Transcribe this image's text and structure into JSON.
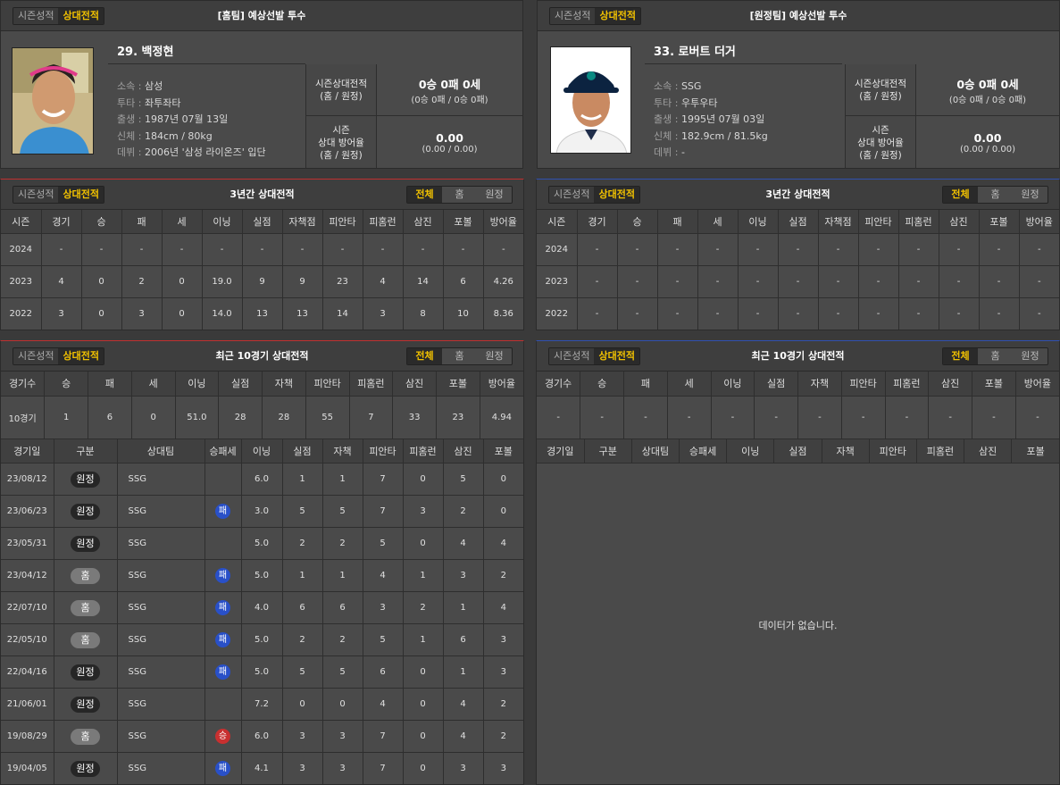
{
  "tabs": {
    "season": "시즌성적",
    "vs": "상대전적",
    "all": "전체",
    "home": "홈",
    "away": "원정"
  },
  "home": {
    "title": "[홈팀] 예상선발 투수",
    "name": "29. 백정현",
    "info": [
      {
        "k": "소속",
        "v": "삼성"
      },
      {
        "k": "투타",
        "v": "좌투좌타"
      },
      {
        "k": "출생",
        "v": "1987년 07월 13일"
      },
      {
        "k": "신체",
        "v": "184cm / 80kg"
      },
      {
        "k": "데뷔",
        "v": "2006년 '삼성 라이온즈' 입단"
      }
    ],
    "record_label_1": "시즌상대전적",
    "record_label_1b": "(홈 / 원정)",
    "record_main": "0승 0패 0세",
    "record_sub": "(0승 0패 / 0승 0패)",
    "era_label_1": "시즌",
    "era_label_2": "상대 방어율",
    "era_label_3": "(홈 / 원정)",
    "era_main": "0.00",
    "era_sub": "(0.00 / 0.00)"
  },
  "away": {
    "title": "[원정팀] 예상선발 투수",
    "name": "33. 로버트 더거",
    "info": [
      {
        "k": "소속",
        "v": "SSG"
      },
      {
        "k": "투타",
        "v": "우투우타"
      },
      {
        "k": "출생",
        "v": "1995년 07월 03일"
      },
      {
        "k": "신체",
        "v": "182.9cm / 81.5kg"
      },
      {
        "k": "데뷔",
        "v": "-"
      }
    ],
    "record_label_1": "시즌상대전적",
    "record_label_1b": "(홈 / 원정)",
    "record_main": "0승 0패 0세",
    "record_sub": "(0승 0패 / 0승 0패)",
    "era_label_1": "시즌",
    "era_label_2": "상대 방어율",
    "era_label_3": "(홈 / 원정)",
    "era_main": "0.00",
    "era_sub": "(0.00 / 0.00)"
  },
  "three_year": {
    "title": "3년간 상대전적",
    "headers": [
      "시즌",
      "경기",
      "승",
      "패",
      "세",
      "이닝",
      "실점",
      "자책점",
      "피안타",
      "피홈런",
      "삼진",
      "포볼",
      "방어율"
    ],
    "home_rows": [
      [
        "2024",
        "-",
        "-",
        "-",
        "-",
        "-",
        "-",
        "-",
        "-",
        "-",
        "-",
        "-",
        "-"
      ],
      [
        "2023",
        "4",
        "0",
        "2",
        "0",
        "19.0",
        "9",
        "9",
        "23",
        "4",
        "14",
        "6",
        "4.26"
      ],
      [
        "2022",
        "3",
        "0",
        "3",
        "0",
        "14.0",
        "13",
        "13",
        "14",
        "3",
        "8",
        "10",
        "8.36"
      ]
    ],
    "away_rows": [
      [
        "2024",
        "-",
        "-",
        "-",
        "-",
        "-",
        "-",
        "-",
        "-",
        "-",
        "-",
        "-",
        "-"
      ],
      [
        "2023",
        "-",
        "-",
        "-",
        "-",
        "-",
        "-",
        "-",
        "-",
        "-",
        "-",
        "-",
        "-"
      ],
      [
        "2022",
        "-",
        "-",
        "-",
        "-",
        "-",
        "-",
        "-",
        "-",
        "-",
        "-",
        "-",
        "-"
      ]
    ]
  },
  "recent": {
    "title": "최근 10경기 상대전적",
    "summary_headers": [
      "경기수",
      "승",
      "패",
      "세",
      "이닝",
      "실점",
      "자책",
      "피안타",
      "피홈런",
      "삼진",
      "포볼",
      "방어율"
    ],
    "home_summary": [
      "10경기",
      "1",
      "6",
      "0",
      "51.0",
      "28",
      "28",
      "55",
      "7",
      "33",
      "23",
      "4.94"
    ],
    "away_summary": [
      "-",
      "-",
      "-",
      "-",
      "-",
      "-",
      "-",
      "-",
      "-",
      "-",
      "-",
      "-"
    ],
    "game_headers": [
      "경기일",
      "구분",
      "상대팀",
      "승패세",
      "이닝",
      "실점",
      "자책",
      "피안타",
      "피홈런",
      "삼진",
      "포볼"
    ],
    "home_games": [
      {
        "date": "23/08/12",
        "type": "원정",
        "team": "SSG",
        "res": "",
        "ip": "6.0",
        "r": "1",
        "er": "1",
        "h": "7",
        "hr": "0",
        "so": "5",
        "bb": "0"
      },
      {
        "date": "23/06/23",
        "type": "원정",
        "team": "SSG",
        "res": "패",
        "ip": "3.0",
        "r": "5",
        "er": "5",
        "h": "7",
        "hr": "3",
        "so": "2",
        "bb": "0"
      },
      {
        "date": "23/05/31",
        "type": "원정",
        "team": "SSG",
        "res": "",
        "ip": "5.0",
        "r": "2",
        "er": "2",
        "h": "5",
        "hr": "0",
        "so": "4",
        "bb": "4"
      },
      {
        "date": "23/04/12",
        "type": "홈",
        "team": "SSG",
        "res": "패",
        "ip": "5.0",
        "r": "1",
        "er": "1",
        "h": "4",
        "hr": "1",
        "so": "3",
        "bb": "2"
      },
      {
        "date": "22/07/10",
        "type": "홈",
        "team": "SSG",
        "res": "패",
        "ip": "4.0",
        "r": "6",
        "er": "6",
        "h": "3",
        "hr": "2",
        "so": "1",
        "bb": "4"
      },
      {
        "date": "22/05/10",
        "type": "홈",
        "team": "SSG",
        "res": "패",
        "ip": "5.0",
        "r": "2",
        "er": "2",
        "h": "5",
        "hr": "1",
        "so": "6",
        "bb": "3"
      },
      {
        "date": "22/04/16",
        "type": "원정",
        "team": "SSG",
        "res": "패",
        "ip": "5.0",
        "r": "5",
        "er": "5",
        "h": "6",
        "hr": "0",
        "so": "1",
        "bb": "3"
      },
      {
        "date": "21/06/01",
        "type": "원정",
        "team": "SSG",
        "res": "",
        "ip": "7.2",
        "r": "0",
        "er": "0",
        "h": "4",
        "hr": "0",
        "so": "4",
        "bb": "2"
      },
      {
        "date": "19/08/29",
        "type": "홈",
        "team": "SSG",
        "res": "승",
        "ip": "6.0",
        "r": "3",
        "er": "3",
        "h": "7",
        "hr": "0",
        "so": "4",
        "bb": "2"
      },
      {
        "date": "19/04/05",
        "type": "원정",
        "team": "SSG",
        "res": "패",
        "ip": "4.1",
        "r": "3",
        "er": "3",
        "h": "7",
        "hr": "0",
        "so": "3",
        "bb": "3"
      }
    ],
    "no_data": "데이터가 없습니다."
  }
}
